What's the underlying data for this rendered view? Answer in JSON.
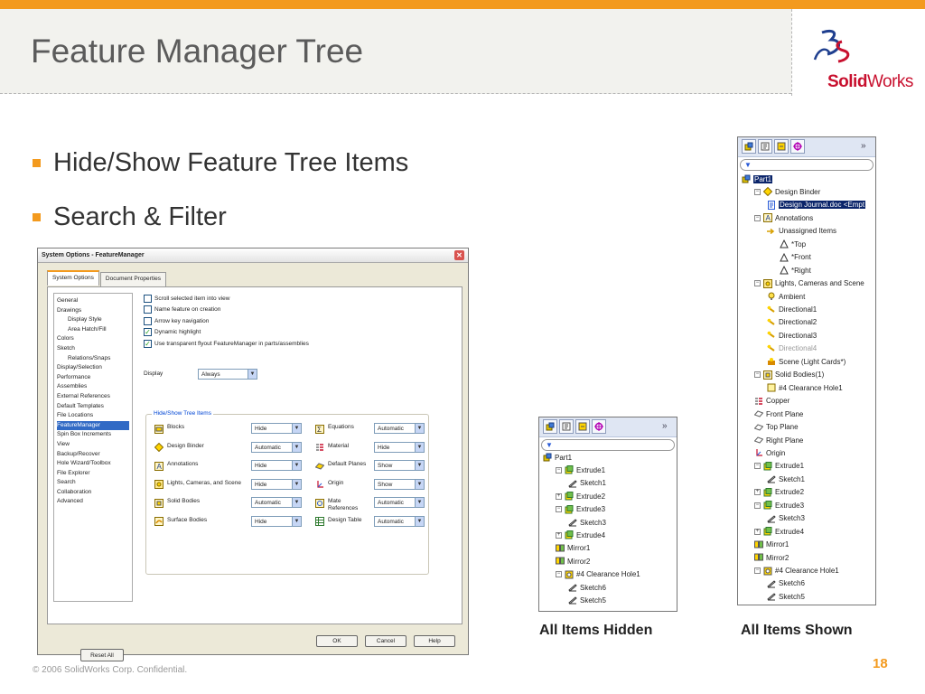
{
  "slide": {
    "title": "Feature Manager Tree",
    "logo_solid": "Solid",
    "logo_works": "Works",
    "bullets": [
      "Hide/Show Feature Tree Items",
      "Search & Filter"
    ],
    "footer": "© 2006 SolidWorks Corp. Confidential.",
    "page_number": "18",
    "accent_color": "#f39a1e"
  },
  "dialog": {
    "title": "System Options - FeatureManager",
    "tabs": [
      "System Options",
      "Document Properties"
    ],
    "categories": [
      {
        "label": "General",
        "sub": false
      },
      {
        "label": "Drawings",
        "sub": false
      },
      {
        "label": "Display Style",
        "sub": true
      },
      {
        "label": "Area Hatch/Fill",
        "sub": true
      },
      {
        "label": "Colors",
        "sub": false
      },
      {
        "label": "Sketch",
        "sub": false
      },
      {
        "label": "Relations/Snaps",
        "sub": true
      },
      {
        "label": "Display/Selection",
        "sub": false
      },
      {
        "label": "Performance",
        "sub": false
      },
      {
        "label": "Assemblies",
        "sub": false
      },
      {
        "label": "External References",
        "sub": false
      },
      {
        "label": "Default Templates",
        "sub": false
      },
      {
        "label": "File Locations",
        "sub": false
      },
      {
        "label": "FeatureManager",
        "sub": false
      },
      {
        "label": "Spin Box Increments",
        "sub": false
      },
      {
        "label": "View",
        "sub": false
      },
      {
        "label": "Backup/Recover",
        "sub": false
      },
      {
        "label": "Hole Wizard/Toolbox",
        "sub": false
      },
      {
        "label": "File Explorer",
        "sub": false
      },
      {
        "label": "Search",
        "sub": false
      },
      {
        "label": "Collaboration",
        "sub": false
      },
      {
        "label": "Advanced",
        "sub": false
      }
    ],
    "selected_category": "FeatureManager",
    "checkboxes": [
      {
        "label": "Scroll selected item into view",
        "checked": false
      },
      {
        "label": "Name feature on creation",
        "checked": false
      },
      {
        "label": "Arrow key navigation",
        "checked": false
      },
      {
        "label": "Dynamic highlight",
        "checked": true
      },
      {
        "label": "Use transparent flyout FeatureManager in parts/assemblies",
        "checked": true
      }
    ],
    "display_label": "Display",
    "display_value": "Always",
    "hide_show_legend": "Hide/Show Tree Items",
    "hide_show_items": [
      {
        "label": "Blocks",
        "value": "Hide",
        "icon": "blocks-icon"
      },
      {
        "label": "Design Binder",
        "value": "Automatic",
        "icon": "design-binder-icon"
      },
      {
        "label": "Annotations",
        "value": "Hide",
        "icon": "annotations-icon"
      },
      {
        "label": "Lights, Cameras, and Scene",
        "value": "Hide",
        "icon": "lights-icon"
      },
      {
        "label": "Solid Bodies",
        "value": "Automatic",
        "icon": "solid-bodies-icon"
      },
      {
        "label": "Surface Bodies",
        "value": "Hide",
        "icon": "surface-bodies-icon"
      },
      {
        "label": "Equations",
        "value": "Automatic",
        "icon": "equations-icon"
      },
      {
        "label": "Material",
        "value": "Hide",
        "icon": "material-icon"
      },
      {
        "label": "Default Planes",
        "value": "Show",
        "icon": "planes-icon"
      },
      {
        "label": "Origin",
        "value": "Show",
        "icon": "origin-icon"
      },
      {
        "label": "Mate References",
        "value": "Automatic",
        "icon": "mate-references-icon"
      },
      {
        "label": "Design Table",
        "value": "Automatic",
        "icon": "design-table-icon"
      }
    ],
    "reset_label": "Reset All",
    "ok_label": "OK",
    "cancel_label": "Cancel",
    "help_label": "Help",
    "close_glyph": "✕"
  },
  "tree_hidden": {
    "caption": "All Items Hidden",
    "more_glyph": "»",
    "nodes": [
      {
        "label": "Part1",
        "indent": 0,
        "exp": "",
        "icon": "part-icon"
      },
      {
        "label": "Extrude1",
        "indent": 1,
        "exp": "−",
        "icon": "extrude-icon"
      },
      {
        "label": "Sketch1",
        "indent": 2,
        "exp": "",
        "icon": "sketch-icon"
      },
      {
        "label": "Extrude2",
        "indent": 1,
        "exp": "+",
        "icon": "extrude-icon"
      },
      {
        "label": "Extrude3",
        "indent": 1,
        "exp": "−",
        "icon": "extrude-icon"
      },
      {
        "label": "Sketch3",
        "indent": 2,
        "exp": "",
        "icon": "sketch-icon"
      },
      {
        "label": "Extrude4",
        "indent": 1,
        "exp": "+",
        "icon": "extrude-icon"
      },
      {
        "label": "Mirror1",
        "indent": 1,
        "exp": "",
        "icon": "mirror-icon"
      },
      {
        "label": "Mirror2",
        "indent": 1,
        "exp": "",
        "icon": "mirror-icon"
      },
      {
        "label": "#4 Clearance Hole1",
        "indent": 1,
        "exp": "−",
        "icon": "hole-icon"
      },
      {
        "label": "Sketch6",
        "indent": 2,
        "exp": "",
        "icon": "sketch-icon"
      },
      {
        "label": "Sketch5",
        "indent": 2,
        "exp": "",
        "icon": "sketch-icon"
      }
    ]
  },
  "tree_shown": {
    "caption": "All Items Shown",
    "more_glyph": "»",
    "nodes": [
      {
        "label": "Part1",
        "indent": 0,
        "exp": "",
        "icon": "part-icon",
        "selected": true
      },
      {
        "label": "Design Binder",
        "indent": 1,
        "exp": "−",
        "icon": "design-binder-icon"
      },
      {
        "label": "Design Journal.doc <Empt",
        "indent": 2,
        "exp": "",
        "icon": "document-icon",
        "selected": true
      },
      {
        "label": "Annotations",
        "indent": 1,
        "exp": "−",
        "icon": "annotations-icon"
      },
      {
        "label": "Unassigned Items",
        "indent": 2,
        "exp": "",
        "icon": "unassigned-icon"
      },
      {
        "label": "*Top",
        "indent": 3,
        "exp": "",
        "icon": "view-icon"
      },
      {
        "label": "*Front",
        "indent": 3,
        "exp": "",
        "icon": "view-icon"
      },
      {
        "label": "*Right",
        "indent": 3,
        "exp": "",
        "icon": "view-icon"
      },
      {
        "label": "Lights, Cameras and Scene",
        "indent": 1,
        "exp": "−",
        "icon": "lights-icon"
      },
      {
        "label": "Ambient",
        "indent": 2,
        "exp": "",
        "icon": "bulb-icon"
      },
      {
        "label": "Directional1",
        "indent": 2,
        "exp": "",
        "icon": "directional-light-icon"
      },
      {
        "label": "Directional2",
        "indent": 2,
        "exp": "",
        "icon": "directional-light-icon"
      },
      {
        "label": "Directional3",
        "indent": 2,
        "exp": "",
        "icon": "directional-light-icon"
      },
      {
        "label": "Directional4",
        "indent": 2,
        "exp": "",
        "icon": "directional-light-icon",
        "gray": true
      },
      {
        "label": "Scene (Light Cards*)",
        "indent": 2,
        "exp": "",
        "icon": "scene-icon"
      },
      {
        "label": "Solid Bodies(1)",
        "indent": 1,
        "exp": "−",
        "icon": "solid-bodies-icon"
      },
      {
        "label": "#4 Clearance Hole1",
        "indent": 2,
        "exp": "",
        "icon": "body-icon"
      },
      {
        "label": "Copper",
        "indent": 1,
        "exp": "",
        "icon": "material-icon"
      },
      {
        "label": "Front Plane",
        "indent": 1,
        "exp": "",
        "icon": "plane-icon"
      },
      {
        "label": "Top Plane",
        "indent": 1,
        "exp": "",
        "icon": "plane-icon"
      },
      {
        "label": "Right Plane",
        "indent": 1,
        "exp": "",
        "icon": "plane-icon"
      },
      {
        "label": "Origin",
        "indent": 1,
        "exp": "",
        "icon": "origin-icon"
      },
      {
        "label": "Extrude1",
        "indent": 1,
        "exp": "−",
        "icon": "extrude-icon"
      },
      {
        "label": "Sketch1",
        "indent": 2,
        "exp": "",
        "icon": "sketch-icon"
      },
      {
        "label": "Extrude2",
        "indent": 1,
        "exp": "+",
        "icon": "extrude-icon"
      },
      {
        "label": "Extrude3",
        "indent": 1,
        "exp": "−",
        "icon": "extrude-icon"
      },
      {
        "label": "Sketch3",
        "indent": 2,
        "exp": "",
        "icon": "sketch-icon"
      },
      {
        "label": "Extrude4",
        "indent": 1,
        "exp": "+",
        "icon": "extrude-icon"
      },
      {
        "label": "Mirror1",
        "indent": 1,
        "exp": "",
        "icon": "mirror-icon"
      },
      {
        "label": "Mirror2",
        "indent": 1,
        "exp": "",
        "icon": "mirror-icon"
      },
      {
        "label": "#4 Clearance Hole1",
        "indent": 1,
        "exp": "−",
        "icon": "hole-icon"
      },
      {
        "label": "Sketch6",
        "indent": 2,
        "exp": "",
        "icon": "sketch-icon"
      },
      {
        "label": "Sketch5",
        "indent": 2,
        "exp": "",
        "icon": "sketch-icon"
      }
    ]
  }
}
